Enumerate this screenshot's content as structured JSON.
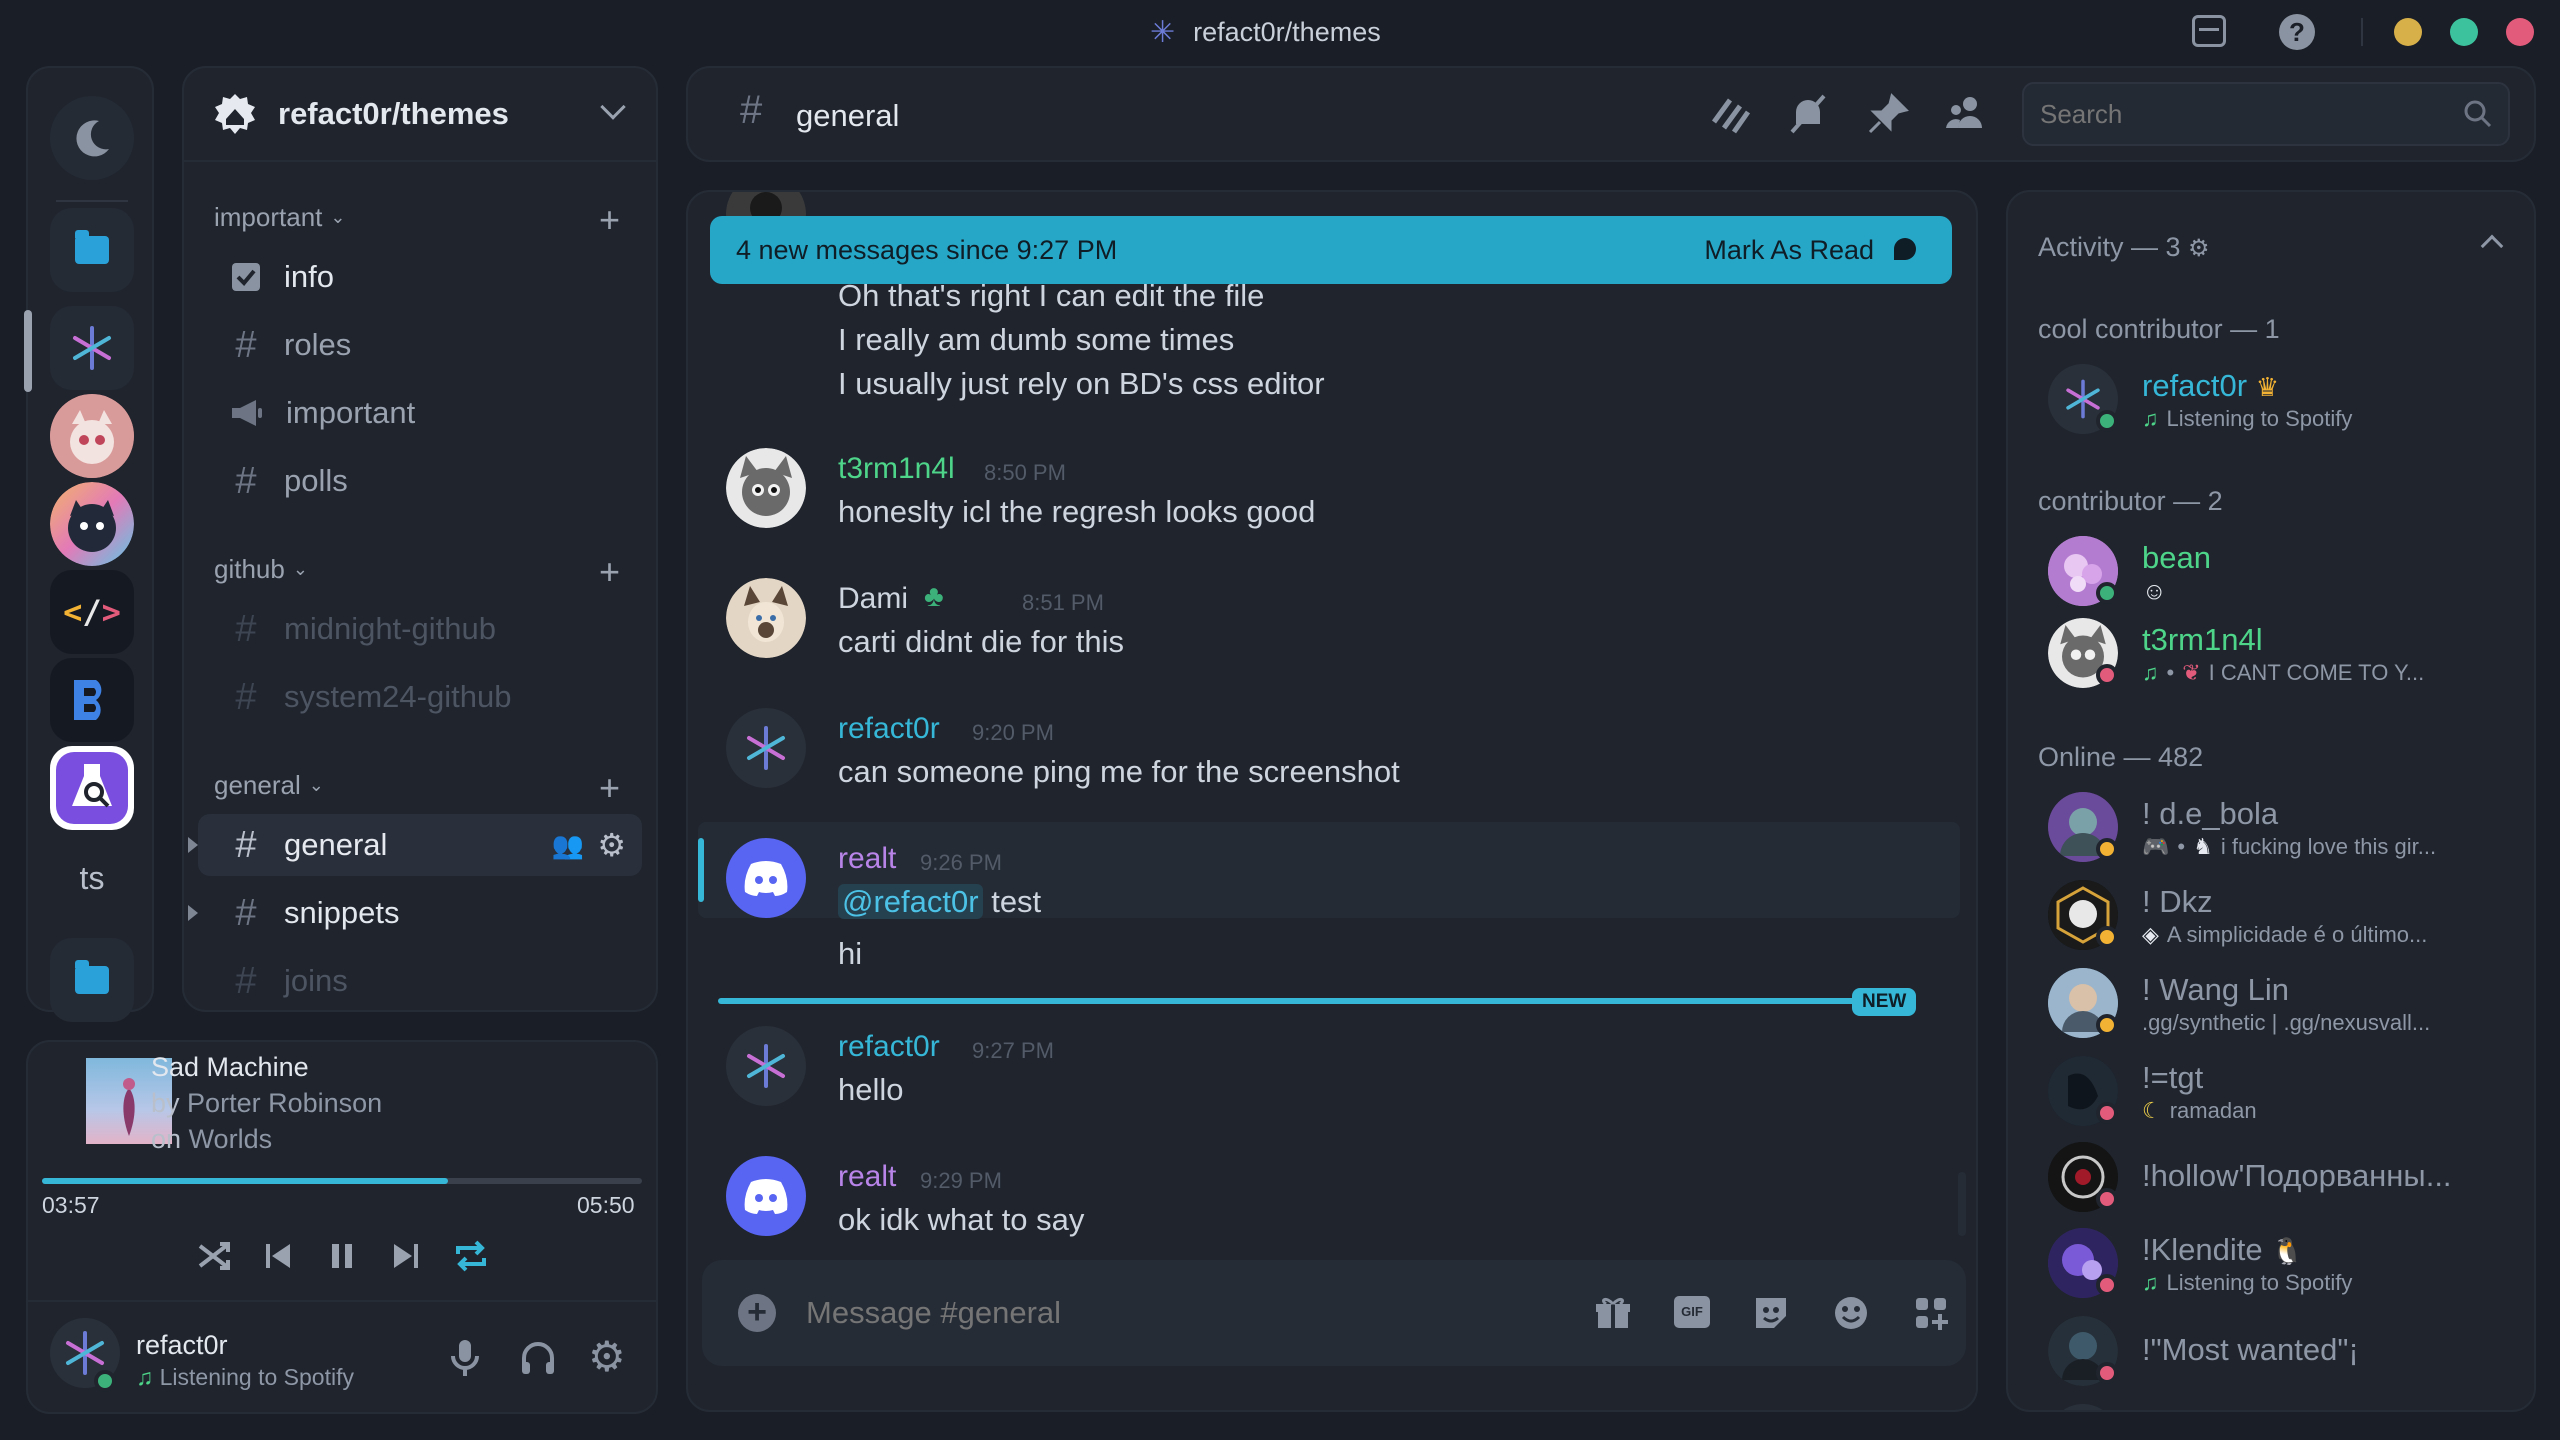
{
  "window": {
    "title": "refact0r/themes",
    "traffic_lights": [
      "#d8b04a",
      "#3cc39e",
      "#e35b7b"
    ]
  },
  "rail": {
    "text_server": "ts"
  },
  "server": {
    "name": "refact0r/themes",
    "categories": [
      {
        "label": "important",
        "channels": [
          {
            "name": "info",
            "icon": "rules-icon"
          },
          {
            "name": "roles",
            "icon": "hash"
          },
          {
            "name": "important",
            "icon": "megaphone-icon"
          },
          {
            "name": "polls",
            "icon": "hash"
          }
        ]
      },
      {
        "label": "github",
        "channels": [
          {
            "name": "midnight-github",
            "icon": "hash"
          },
          {
            "name": "system24-github",
            "icon": "hash"
          }
        ]
      },
      {
        "label": "general",
        "channels": [
          {
            "name": "general",
            "icon": "hash",
            "active": true
          },
          {
            "name": "snippets",
            "icon": "hash"
          },
          {
            "name": "joins",
            "icon": "hash"
          }
        ]
      }
    ]
  },
  "music": {
    "track": "Sad Machine",
    "by_prefix": "by",
    "artist": "Porter Robinson",
    "on_prefix": "on",
    "album": "Worlds",
    "elapsed": "03:57",
    "duration": "05:50",
    "progress": 0.677
  },
  "user": {
    "name": "refact0r",
    "status": "Listening to Spotify"
  },
  "header": {
    "channel": "general",
    "search_placeholder": "Search"
  },
  "chat": {
    "banner_text": "4 new messages since 9:27 PM",
    "banner_action": "Mark As Read",
    "new_label": "NEW",
    "composer_placeholder": "Message #general",
    "messages": [
      {
        "lines": [
          "Oh that's right I can edit the file",
          "I really am dumb some times",
          "I usually just rely on BD's css editor"
        ]
      },
      {
        "author": "t3rm1n4l",
        "time": "8:50 PM",
        "color": "#4ed58a",
        "lines": [
          "honeslty icl the regresh looks good"
        ]
      },
      {
        "author": "Dami",
        "time": "8:51 PM",
        "color": "#cfd5de",
        "lines": [
          "carti didnt die for this"
        ]
      },
      {
        "author": "refact0r",
        "time": "9:20 PM",
        "color": "#36b7d7",
        "lines": [
          "can someone ping me for the screenshot"
        ]
      },
      {
        "author": "realt",
        "time": "9:26 PM",
        "color": "#b884e8",
        "mention": "@refact0r",
        "lines": [
          "test",
          "hi"
        ]
      },
      {
        "author": "refact0r",
        "time": "9:27 PM",
        "color": "#36b7d7",
        "lines": [
          "hello"
        ]
      },
      {
        "author": "realt",
        "time": "9:29 PM",
        "color": "#b884e8",
        "lines": [
          "ok idk what to say"
        ]
      }
    ]
  },
  "members": {
    "activity_header": "Activity — 3",
    "groups": [
      {
        "label": "cool contributor — 1"
      },
      {
        "label": "contributor — 2"
      },
      {
        "label": "Online — 482"
      }
    ],
    "list": [
      {
        "name": "refact0r",
        "sub": "Listening to Spotify",
        "color": "#36b7d7"
      },
      {
        "name": "bean",
        "sub": "",
        "color": "#4ed58a"
      },
      {
        "name": "t3rm1n4l",
        "sub": "I CANT COME TO Y...",
        "color": "#4ed58a"
      },
      {
        "name": "! d.e_bola",
        "sub": "i fucking love this gir...",
        "color": "#8e97a6"
      },
      {
        "name": "! Dkz",
        "sub": "A simplicidade é o último...",
        "color": "#8e97a6"
      },
      {
        "name": "! Wang Lin",
        "sub": ".gg/synthetic | .gg/nexusvall...",
        "color": "#8e97a6"
      },
      {
        "name": "!=tgt",
        "sub": "ramadan",
        "color": "#8e97a6"
      },
      {
        "name": "!hollow'Подорванны...",
        "sub": "",
        "color": "#8e97a6"
      },
      {
        "name": "!Klendite",
        "sub": "Listening to Spotify",
        "color": "#8e97a6"
      },
      {
        "name": "!\"Most wanted\"¡",
        "sub": "",
        "color": "#8e97a6"
      }
    ]
  }
}
